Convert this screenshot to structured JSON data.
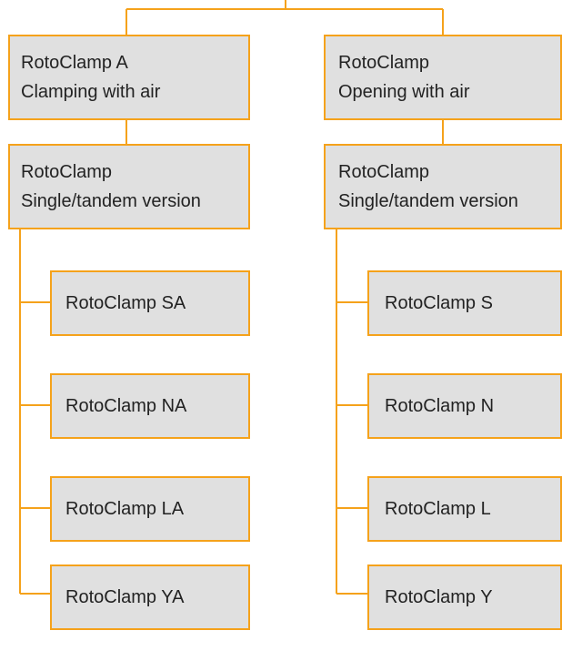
{
  "colors": {
    "connector": "#f5a21b",
    "box_fill": "#e0e0e0",
    "text": "#222222"
  },
  "left_branch": {
    "root": {
      "line1": "RotoClamp A",
      "line2": "Clamping with air"
    },
    "group": {
      "line1": "RotoClamp",
      "line2": "Single/tandem version"
    },
    "leaves": [
      "RotoClamp SA",
      "RotoClamp NA",
      "RotoClamp LA",
      "RotoClamp YA"
    ]
  },
  "right_branch": {
    "root": {
      "line1": "RotoClamp",
      "line2": "Opening with air"
    },
    "group": {
      "line1": "RotoClamp",
      "line2": "Single/tandem version"
    },
    "leaves": [
      "RotoClamp S",
      "RotoClamp N",
      "RotoClamp L",
      "RotoClamp Y"
    ]
  }
}
